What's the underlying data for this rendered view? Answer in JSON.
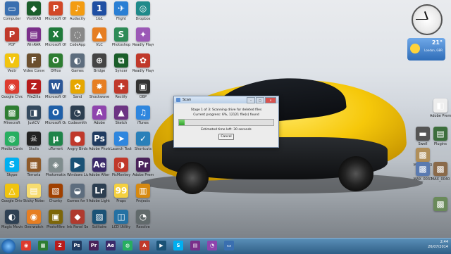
{
  "desktop_icons": [
    {
      "label": "Computer",
      "glyph": "▭",
      "color": "#3a6fb0"
    },
    {
      "label": "VisitKAB",
      "glyph": "◆",
      "color": "#1a5e2a"
    },
    {
      "label": "Microsoft Office Po...",
      "glyph": "P",
      "color": "#d24726"
    },
    {
      "label": "Audacity",
      "glyph": "♪",
      "color": "#f39c12"
    },
    {
      "label": "1&1",
      "glyph": "1",
      "color": "#1f4fa3"
    },
    {
      "label": "Flight",
      "glyph": "✈",
      "color": "#2a7fd4"
    },
    {
      "label": "Dropbox",
      "glyph": "◎",
      "color": "#1f8a8a"
    },
    {
      "label": "PDF",
      "glyph": "P",
      "color": "#c0392b"
    },
    {
      "label": "WinRAR",
      "glyph": "▤",
      "color": "#7a2f8a"
    },
    {
      "label": "Microsoft Office Exc...",
      "glyph": "X",
      "color": "#1f7a3a"
    },
    {
      "label": "CodeApp",
      "glyph": "◌",
      "color": "#888888"
    },
    {
      "label": "VLC",
      "glyph": "▲",
      "color": "#e67e22"
    },
    {
      "label": "Photoshop",
      "glyph": "S",
      "color": "#2e8b57"
    },
    {
      "label": "Readly Player",
      "glyph": "✦",
      "color": "#9b59b6"
    },
    {
      "label": "Vectr",
      "glyph": "V",
      "color": "#f1c40f"
    },
    {
      "label": "Video Converter",
      "glyph": "F",
      "color": "#6b4f2e"
    },
    {
      "label": "Office",
      "glyph": "O",
      "color": "#2e7d32"
    },
    {
      "label": "Games",
      "glyph": "◐",
      "color": "#5d6d7e"
    },
    {
      "label": "Bridge",
      "glyph": "⊕",
      "color": "#444444"
    },
    {
      "label": "Syncer",
      "glyph": "⧉",
      "color": "#1a5e2a"
    },
    {
      "label": "Readly Player Photo",
      "glyph": "✿",
      "color": "#c0392b"
    },
    {
      "label": "Google Chrome",
      "glyph": "◉",
      "color": "#dd3b2f"
    },
    {
      "label": "FileZilla",
      "glyph": "Z",
      "color": "#b71c1c"
    },
    {
      "label": "Microsoft Office Word",
      "glyph": "W",
      "color": "#2b5797"
    },
    {
      "label": "Sand",
      "glyph": "✿",
      "color": "#e6a700"
    },
    {
      "label": "Shockwave",
      "glyph": "✸",
      "color": "#e67e22"
    },
    {
      "label": "Rectify",
      "glyph": "✚",
      "color": "#c0392b"
    },
    {
      "label": "OBP",
      "glyph": "▣",
      "color": "#333333"
    },
    {
      "label": "Minecraft",
      "glyph": "▩",
      "color": "#2e7d32"
    },
    {
      "label": "JustCV",
      "glyph": "◨",
      "color": "#34495e"
    },
    {
      "label": "Microsoft Outlook",
      "glyph": "O",
      "color": "#1f5fa8"
    },
    {
      "label": "Codesmith",
      "glyph": "◔",
      "color": "#2c3e50"
    },
    {
      "label": "Adobe",
      "glyph": "A",
      "color": "#8e44ad"
    },
    {
      "label": "Sketch",
      "glyph": "▲",
      "color": "#6c3483"
    },
    {
      "label": "iTunes",
      "glyph": "♫",
      "color": "#2e86de"
    },
    {
      "label": "Media Center",
      "glyph": "◍",
      "color": "#27ae60"
    },
    {
      "label": "Skulls",
      "glyph": "☠",
      "color": "#222222"
    },
    {
      "label": "uTorrent",
      "glyph": "µ",
      "color": "#1e8449"
    },
    {
      "label": "Angry Birds",
      "glyph": "●",
      "color": "#c0392b"
    },
    {
      "label": "Adobe Photoshop",
      "glyph": "Ps",
      "color": "#1f3a5f"
    },
    {
      "label": "Launch Tools",
      "glyph": "➤",
      "color": "#2e86de"
    },
    {
      "label": "Shortcuts",
      "glyph": "✓",
      "color": "#2980b9"
    },
    {
      "label": "Skype",
      "glyph": "S",
      "color": "#00aff0"
    },
    {
      "label": "Terraria",
      "glyph": "▦",
      "color": "#8e5a2a"
    },
    {
      "label": "Photomatix",
      "glyph": "◈",
      "color": "#7f8c8d"
    },
    {
      "label": "Windows Live Movie",
      "glyph": "▶",
      "color": "#1a5276"
    },
    {
      "label": "Adobe After Effects CS5",
      "glyph": "Ae",
      "color": "#3b2a6a"
    },
    {
      "label": "PicMonkey",
      "glyph": "◑",
      "color": "#c0392b"
    },
    {
      "label": "Adobe Premiere",
      "glyph": "Pr",
      "color": "#4a235a"
    },
    {
      "label": "Google Drive",
      "glyph": "△",
      "color": "#f1c40f"
    },
    {
      "label": "Sticky Notes",
      "glyph": "▤",
      "color": "#f7dc6f"
    },
    {
      "label": "Chunky",
      "glyph": "▧",
      "color": "#a04000"
    },
    {
      "label": "Games for Windows",
      "glyph": "◒",
      "color": "#5d6d7e"
    },
    {
      "label": "Adobe Lightroom",
      "glyph": "Lr",
      "color": "#2c3e50"
    },
    {
      "label": "Fraps",
      "glyph": "99",
      "color": "#f4d03f"
    },
    {
      "label": "Projects",
      "glyph": "▥",
      "color": "#d68910"
    },
    {
      "label": "Magix Movie",
      "glyph": "◐",
      "color": "#2e4053"
    },
    {
      "label": "Overwatch",
      "glyph": "◉",
      "color": "#e67e22"
    },
    {
      "label": "Photofiltre",
      "glyph": "▣",
      "color": "#7d6608"
    },
    {
      "label": "Ink Panel Selection",
      "glyph": "◆",
      "color": "#b03a2e"
    },
    {
      "label": "Solitaire",
      "glyph": "▧",
      "color": "#1a5276"
    },
    {
      "label": "LCD Utility",
      "glyph": "◫",
      "color": "#2471a3"
    },
    {
      "label": "Resolve",
      "glyph": "◔",
      "color": "#616a6b"
    }
  ],
  "right_icons": [
    {
      "label": "Adobe Premiere Pr...",
      "glyph": "◧",
      "color": "#eeeeee"
    },
    {
      "label": "Swell",
      "glyph": "▬",
      "color": "#555555"
    },
    {
      "label": "Plugins",
      "glyph": "▤",
      "color": "#3c6e3c"
    },
    {
      "label": "MAX_0033",
      "glyph": "▩",
      "color": "#b08f5a"
    },
    {
      "label": "MAX_0037",
      "glyph": "▩",
      "color": "#5a7ab0"
    },
    {
      "label": "MAX_0040",
      "glyph": "▩",
      "color": "#8a6a4a"
    },
    {
      "label": "",
      "glyph": "▩",
      "color": "#6a8a5a"
    }
  ],
  "dialog": {
    "title": "Scan",
    "stage": "Stage 1 of 3: Scanning drive for deleted files",
    "progress_text": "Current progress: 6%, 12121 file(s) found",
    "progress": 0.06,
    "time_left": "Estimated time left: 30 seconds",
    "cancel_label": "Cancel"
  },
  "weather": {
    "temp": "21°",
    "location": "London, GBR",
    "condition": ""
  },
  "taskbar": {
    "apps": [
      {
        "glyph": "◉",
        "color": "#dd3b2f"
      },
      {
        "glyph": "▩",
        "color": "#2e7d32"
      },
      {
        "glyph": "Z",
        "color": "#b71c1c"
      },
      {
        "glyph": "Ps",
        "color": "#1f3a5f"
      },
      {
        "glyph": "Pr",
        "color": "#4a235a"
      },
      {
        "glyph": "Ae",
        "color": "#3b2a6a"
      },
      {
        "glyph": "◍",
        "color": "#27ae60"
      },
      {
        "glyph": "A",
        "color": "#c0392b"
      },
      {
        "glyph": "▶",
        "color": "#1a5276"
      },
      {
        "glyph": "S",
        "color": "#00aff0"
      },
      {
        "glyph": "▤",
        "color": "#7a2f8a"
      },
      {
        "glyph": "◔",
        "color": "#8e44ad"
      },
      {
        "glyph": "▭",
        "color": "#3a6fb0"
      }
    ],
    "time": "2:44",
    "date": "26/07/2014"
  }
}
